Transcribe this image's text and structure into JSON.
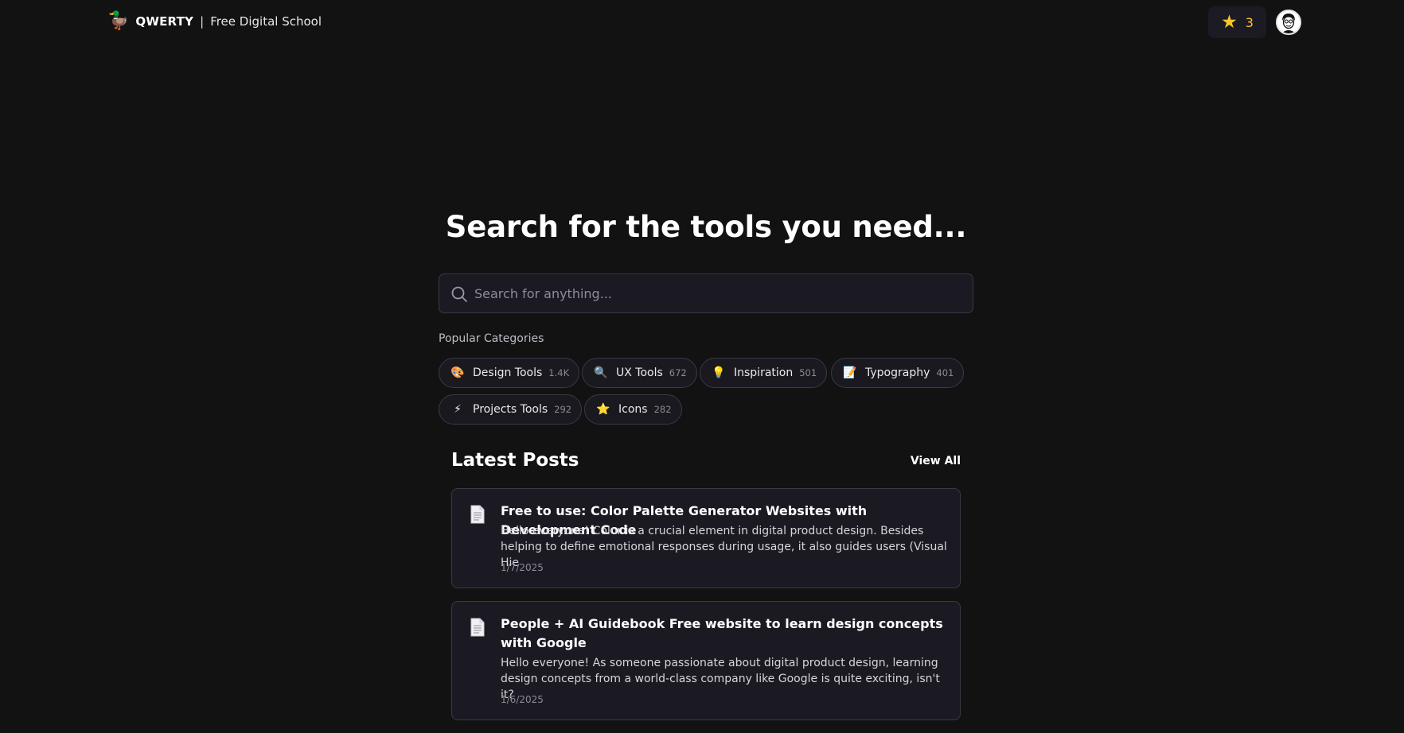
{
  "header": {
    "brand_name": "QWERTY",
    "brand_separator": "|",
    "brand_tagline": "Free Digital School",
    "logo_icon": "duck-icon",
    "star_count": "3",
    "accent_color": "#f7c52c"
  },
  "hero": {
    "title": "Search for the tools you need...",
    "search_placeholder": "Search for anything..."
  },
  "categories": {
    "title": "Popular Categories",
    "items": [
      {
        "icon": "palette-icon",
        "emoji": "🎨",
        "label": "Design Tools",
        "count": "1.4K"
      },
      {
        "icon": "magnifier-icon",
        "emoji": "🔍",
        "label": "UX Tools",
        "count": "672"
      },
      {
        "icon": "lightbulb-icon",
        "emoji": "💡",
        "label": "Inspiration",
        "count": "501"
      },
      {
        "icon": "memo-icon",
        "emoji": "📝",
        "label": "Typography",
        "count": "401"
      },
      {
        "icon": "lightning-icon",
        "emoji": "⚡",
        "label": "Projects Tools",
        "count": "292"
      },
      {
        "icon": "star-icon",
        "emoji": "⭐",
        "label": "Icons",
        "count": "282"
      }
    ]
  },
  "posts": {
    "title": "Latest Posts",
    "view_all": "View All",
    "items": [
      {
        "title": "Free to use: Color Palette Generator Websites with Development Code",
        "excerpt": "Hello everyone! Color is a crucial element in digital product design. Besides helping to define emotional responses during usage, it also guides users (Visual Hie",
        "date": "1/7/2025"
      },
      {
        "title": "People + AI Guidebook Free website to learn design concepts with Google",
        "excerpt": "Hello everyone! As someone passionate about digital product design, learning design concepts from a world-class company like Google is quite exciting, isn't it?",
        "date": "1/6/2025"
      }
    ]
  }
}
